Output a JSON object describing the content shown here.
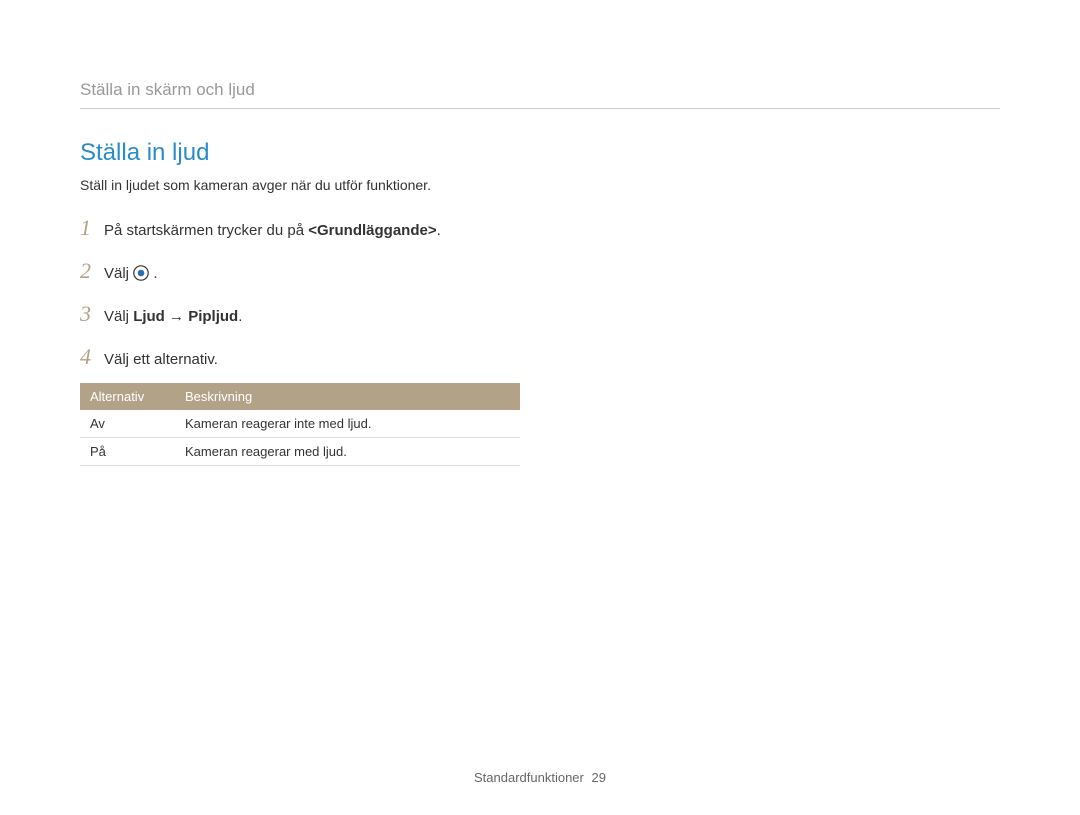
{
  "breadcrumb": "Ställa in skärm och ljud",
  "section": {
    "title": "Ställa in ljud",
    "intro": "Ställ in ljudet som kameran avger när du utför funktioner."
  },
  "steps": {
    "1": {
      "num": "1",
      "pre": "På startskärmen trycker du på ",
      "bold": "<Grundläggande>",
      "post": "."
    },
    "2": {
      "num": "2",
      "pre": "Välj ",
      "icon": "record",
      "post": "."
    },
    "3": {
      "num": "3",
      "pre": "Välj ",
      "bold1": "Ljud",
      "arrow": " → ",
      "bold2": "Pipljud",
      "post": "."
    },
    "4": {
      "num": "4",
      "text": "Välj ett alternativ."
    }
  },
  "table": {
    "headers": {
      "col1": "Alternativ",
      "col2": "Beskrivning"
    },
    "rows": [
      {
        "col1": "Av",
        "col2": "Kameran reagerar inte med ljud."
      },
      {
        "col1": "På",
        "col2": "Kameran reagerar med ljud."
      }
    ]
  },
  "footer": {
    "label": "Standardfunktioner",
    "page": "29"
  }
}
